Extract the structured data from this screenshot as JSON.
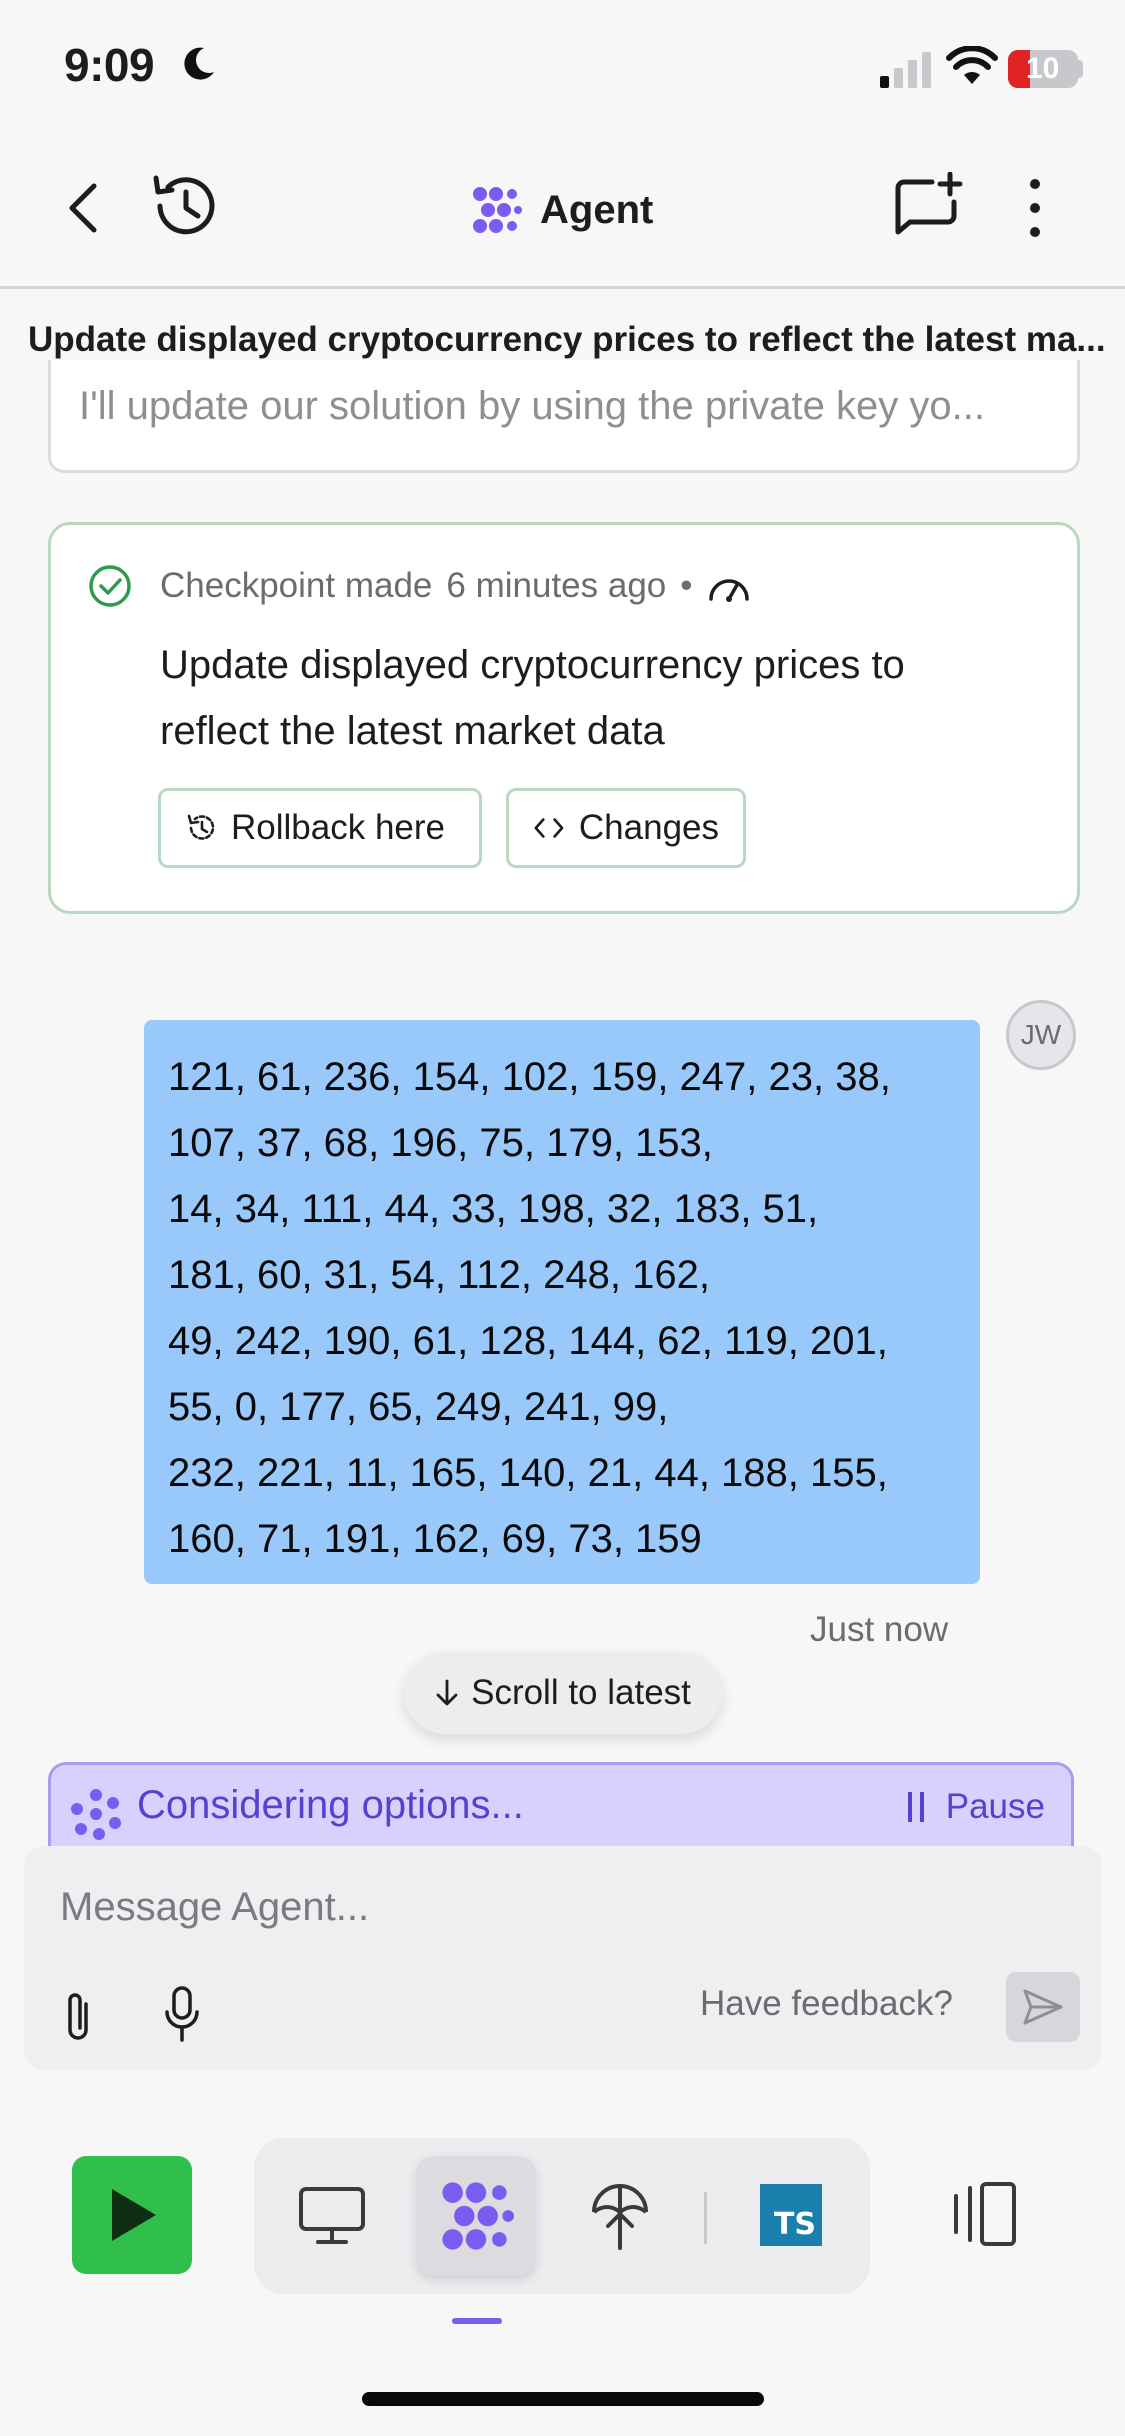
{
  "status_bar": {
    "time": "9:09",
    "battery_level": "10"
  },
  "header": {
    "title": "Agent",
    "thread_title": "Update displayed cryptocurrency prices to reflect the latest ma..."
  },
  "previous_message": {
    "text": "I'll update our solution by using the private key yo..."
  },
  "checkpoint": {
    "meta_prefix": "Checkpoint made",
    "meta_time": "6 minutes ago",
    "separator": "•",
    "description": "Update displayed cryptocurrency prices to reflect the latest market data",
    "rollback_label": "Rollback here",
    "changes_label": "Changes"
  },
  "user_message": {
    "avatar_initials": "JW",
    "body": "121, 61, 236, 154, 102, 159, 247, 23, 38,\n107, 37, 68, 196, 75, 179, 153,\n14, 34, 111, 44, 33, 198, 32, 183, 51,\n181, 60, 31, 54, 112, 248, 162,\n49, 242, 190, 61, 128, 144, 62, 119, 201,\n55, 0, 177, 65, 249, 241, 99,\n232, 221, 11, 165, 140, 21, 44, 188, 155,\n160, 71, 191, 162, 69, 73, 159",
    "timestamp": "Just now"
  },
  "scroll_button": {
    "label": "Scroll to latest"
  },
  "agent_status": {
    "label": "Considering options...",
    "pause_label": "Pause"
  },
  "composer": {
    "placeholder": "Message Agent...",
    "feedback_label": "Have feedback?"
  },
  "toolbar": {
    "ts_label": "TS"
  },
  "colors": {
    "accent_purple": "#7b5cf0",
    "bubble_blue": "#99c9fb",
    "checkpoint_green": "#2e9b4a",
    "run_green": "#2fbf4a",
    "typescript_blue": "#1a7fad"
  }
}
